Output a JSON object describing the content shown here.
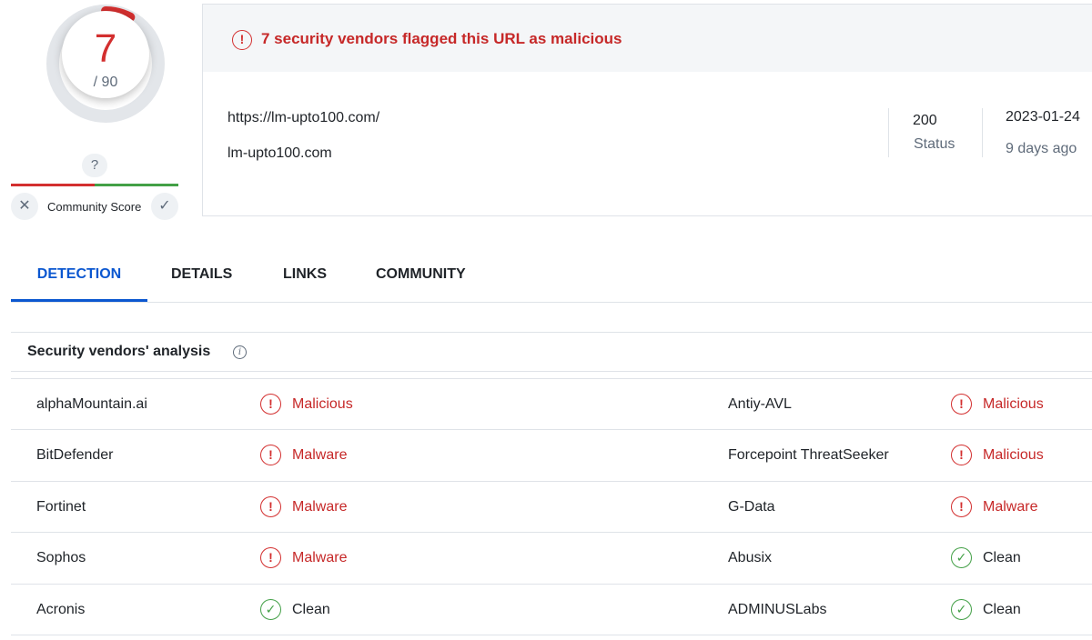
{
  "score": {
    "detections": "7",
    "total": "/ 90",
    "ring_fill_fraction": 0.078,
    "colors": {
      "malicious": "#d32f2f",
      "ring_track": "#e3e6ea"
    }
  },
  "community": {
    "unknown_icon": "?",
    "label": "Community Score",
    "down_icon": "✕",
    "up_icon": "✓"
  },
  "summary": {
    "alert_icon": "!",
    "alert_text": "7 security vendors flagged this URL as malicious",
    "url": "https://lm-upto100.com/",
    "host": "lm-upto100.com",
    "status_code": "200",
    "status_label": "Status",
    "date": "2023-01-24",
    "date_ago": "9 days ago"
  },
  "tabs": [
    {
      "label": "DETECTION",
      "active": true
    },
    {
      "label": "DETAILS",
      "active": false
    },
    {
      "label": "LINKS",
      "active": false
    },
    {
      "label": "COMMUNITY",
      "active": false
    }
  ],
  "vendors": {
    "title": "Security vendors' analysis",
    "info_icon": "i",
    "rows": [
      {
        "left_name": "alphaMountain.ai",
        "left_result": "Malicious",
        "left_status": "bad",
        "right_name": "Antiy-AVL",
        "right_result": "Malicious",
        "right_status": "bad"
      },
      {
        "left_name": "BitDefender",
        "left_result": "Malware",
        "left_status": "bad",
        "right_name": "Forcepoint ThreatSeeker",
        "right_result": "Malicious",
        "right_status": "bad"
      },
      {
        "left_name": "Fortinet",
        "left_result": "Malware",
        "left_status": "bad",
        "right_name": "G-Data",
        "right_result": "Malware",
        "right_status": "bad"
      },
      {
        "left_name": "Sophos",
        "left_result": "Malware",
        "left_status": "bad",
        "right_name": "Abusix",
        "right_result": "Clean",
        "right_status": "ok"
      },
      {
        "left_name": "Acronis",
        "left_result": "Clean",
        "left_status": "ok",
        "right_name": "ADMINUSLabs",
        "right_result": "Clean",
        "right_status": "ok"
      }
    ],
    "icons": {
      "bad": "!",
      "ok": "✓"
    }
  }
}
